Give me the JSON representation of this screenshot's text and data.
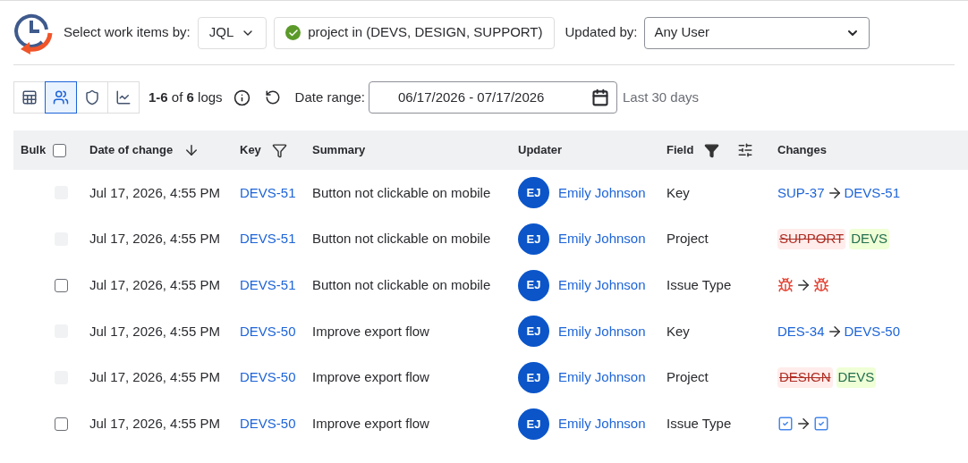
{
  "filter_bar": {
    "select_label": "Select work items by:",
    "mode_dropdown": {
      "value": "JQL"
    },
    "query": {
      "text": "project in (DEVS, DESIGN, SUPPORT)",
      "valid": true
    },
    "updated_by_label": "Updated by:",
    "updated_by": {
      "value": "Any User"
    }
  },
  "toolbar": {
    "views": [
      {
        "kind": "table",
        "selected": false
      },
      {
        "kind": "users",
        "selected": true
      },
      {
        "kind": "shield",
        "selected": false
      },
      {
        "kind": "chart",
        "selected": false
      }
    ],
    "count": "**1-6** of **6** logs",
    "date_label": "Date range:",
    "date_range": {
      "value": "06/17/2026 - 07/17/2026"
    },
    "date_hint": "Last 30 days"
  },
  "table": {
    "columns": [
      {
        "label": "Bulk",
        "kind": "bulk"
      },
      {
        "label": "Date of change",
        "kind": "sort"
      },
      {
        "label": "Key",
        "kind": "filter"
      },
      {
        "label": "Summary",
        "kind": "plain"
      },
      {
        "label": "Updater",
        "kind": "plain"
      },
      {
        "label": "Field",
        "kind": "field"
      },
      {
        "label": "Changes",
        "kind": "plain"
      }
    ],
    "bulk_all": {
      "checked": false
    },
    "rows": [
      {
        "disabled": true,
        "checked": false,
        "date": "Jul 17, 2026, 4:55 PM",
        "key": "DEVS-51",
        "summary": "Button not clickable on mobile",
        "avatar": "EJ",
        "updater": "Emily Johnson",
        "field": "Key",
        "change": {
          "kind": "key",
          "from": "SUP-37",
          "to": "DEVS-51"
        }
      },
      {
        "disabled": true,
        "checked": false,
        "date": "Jul 17, 2026, 4:55 PM",
        "key": "DEVS-51",
        "summary": "Button not clickable on mobile",
        "avatar": "EJ",
        "updater": "Emily Johnson",
        "field": "Project",
        "change": {
          "kind": "project",
          "from": "SUPPORT",
          "to": "DEVS"
        }
      },
      {
        "disabled": false,
        "checked": false,
        "date": "Jul 17, 2026, 4:55 PM",
        "key": "DEVS-51",
        "summary": "Button not clickable on mobile",
        "avatar": "EJ",
        "updater": "Emily Johnson",
        "field": "Issue Type",
        "change": {
          "kind": "type",
          "from": {
            "kind": "bug"
          },
          "to": {
            "kind": "bug"
          }
        }
      },
      {
        "disabled": true,
        "checked": false,
        "date": "Jul 17, 2026, 4:55 PM",
        "key": "DEVS-50",
        "summary": "Improve export flow",
        "avatar": "EJ",
        "updater": "Emily Johnson",
        "field": "Key",
        "change": {
          "kind": "key",
          "from": "DES-34",
          "to": "DEVS-50"
        }
      },
      {
        "disabled": true,
        "checked": false,
        "date": "Jul 17, 2026, 4:55 PM",
        "key": "DEVS-50",
        "summary": "Improve export flow",
        "avatar": "EJ",
        "updater": "Emily Johnson",
        "field": "Project",
        "change": {
          "kind": "project",
          "from": "DESIGN",
          "to": "DEVS"
        }
      },
      {
        "disabled": false,
        "checked": false,
        "date": "Jul 17, 2026, 4:55 PM",
        "key": "DEVS-50",
        "summary": "Improve export flow",
        "avatar": "EJ",
        "updater": "Emily Johnson",
        "field": "Issue Type",
        "change": {
          "kind": "type",
          "from": {
            "kind": "task"
          },
          "to": {
            "kind": "task"
          }
        }
      }
    ]
  }
}
